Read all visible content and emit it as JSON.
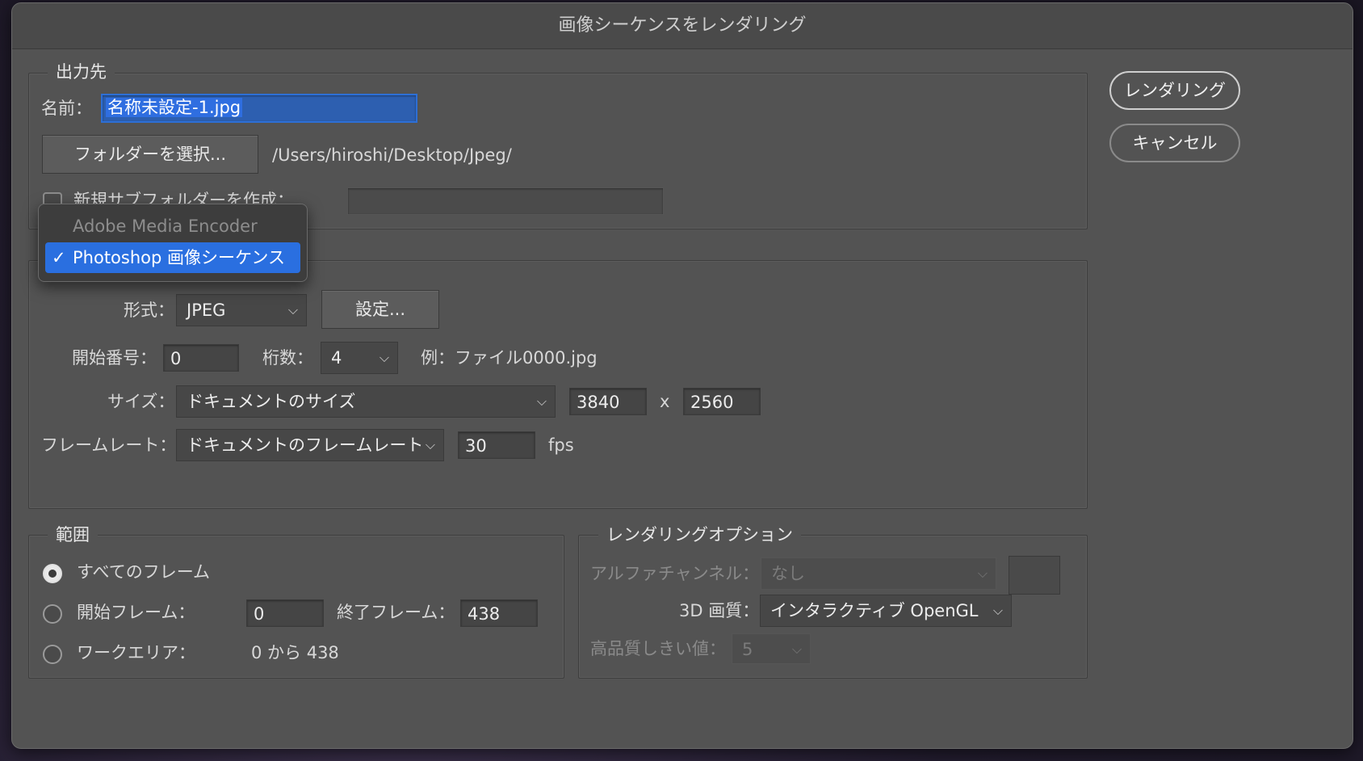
{
  "dialog": {
    "title": "画像シーケンスをレンダリング",
    "render_button": "レンダリング",
    "cancel_button": "キャンセル"
  },
  "output": {
    "group_title": "出力先",
    "name_label": "名前：",
    "name_value": "名称未設定-1.jpg",
    "choose_folder_button": "フォルダーを選択...",
    "folder_path": "/Users/hiroshi/Desktop/Jpeg/",
    "create_subfolder_label": "新規サブフォルダーを作成：",
    "create_subfolder_checked": false,
    "subfolder_value": ""
  },
  "renderer_menu": {
    "items": [
      {
        "label": "Adobe Media Encoder",
        "enabled": false
      },
      {
        "label": "Photoshop 画像シーケンス",
        "enabled": true,
        "selected": true
      }
    ],
    "check_mark": "✓"
  },
  "format": {
    "format_label": "形式：",
    "format_value": "JPEG",
    "settings_button": "設定...",
    "start_number_label": "開始番号：",
    "start_number_value": "0",
    "digits_label": "桁数：",
    "digits_value": "4",
    "example_text": "例：ファイル0000.jpg",
    "size_label": "サイズ：",
    "size_value": "ドキュメントのサイズ",
    "width_value": "3840",
    "times_sign": "x",
    "height_value": "2560",
    "framerate_label": "フレームレート：",
    "framerate_value": "ドキュメントのフレームレート",
    "fps_value": "30",
    "fps_unit": "fps"
  },
  "range": {
    "group_title": "範囲",
    "all_frames_label": "すべてのフレーム",
    "start_frame_label": "開始フレーム：",
    "start_frame_value": "0",
    "end_frame_label": "終了フレーム：",
    "end_frame_value": "438",
    "work_area_label": "ワークエリア：",
    "work_area_value": "0 から 438",
    "selected": "all_frames"
  },
  "render_options": {
    "group_title": "レンダリングオプション",
    "alpha_label": "アルファチャンネル：",
    "alpha_value": "なし",
    "quality_label": "3D 画質：",
    "quality_value": "インタラクティブ OpenGL",
    "threshold_label": "高品質しきい値：",
    "threshold_value": "5"
  },
  "colors": {
    "dialog_bg": "#535353",
    "accent": "#2a6fe0"
  }
}
